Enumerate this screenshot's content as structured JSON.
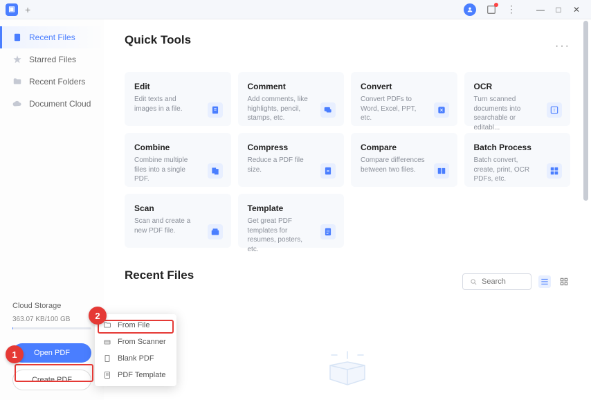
{
  "titlebar": {
    "new_tab": "+"
  },
  "sidebar": {
    "items": [
      {
        "label": "Recent Files"
      },
      {
        "label": "Starred Files"
      },
      {
        "label": "Recent Folders"
      },
      {
        "label": "Document Cloud"
      }
    ],
    "cloud_title": "Cloud Storage",
    "cloud_usage": "363.07 KB/100 GB",
    "open_pdf": "Open PDF",
    "create_pdf": "Create PDF"
  },
  "quick_tools": {
    "title": "Quick Tools",
    "tools": [
      {
        "title": "Edit",
        "desc": "Edit texts and images in a file."
      },
      {
        "title": "Comment",
        "desc": "Add comments, like highlights, pencil, stamps, etc."
      },
      {
        "title": "Convert",
        "desc": "Convert PDFs to Word, Excel, PPT, etc."
      },
      {
        "title": "OCR",
        "desc": "Turn scanned documents into searchable or editabl..."
      },
      {
        "title": "Combine",
        "desc": "Combine multiple files into a single PDF."
      },
      {
        "title": "Compress",
        "desc": "Reduce a PDF file size."
      },
      {
        "title": "Compare",
        "desc": "Compare differences between two files."
      },
      {
        "title": "Batch Process",
        "desc": "Batch convert, create, print, OCR PDFs, etc."
      },
      {
        "title": "Scan",
        "desc": "Scan and create a new PDF file."
      },
      {
        "title": "Template",
        "desc": "Get great PDF templates for resumes, posters, etc."
      }
    ]
  },
  "recent": {
    "title": "Recent Files",
    "search_placeholder": "Search"
  },
  "create_menu": {
    "items": [
      {
        "label": "From File"
      },
      {
        "label": "From Scanner"
      },
      {
        "label": "Blank PDF"
      },
      {
        "label": "PDF Template"
      }
    ]
  },
  "annotations": {
    "a1": "1",
    "a2": "2"
  }
}
